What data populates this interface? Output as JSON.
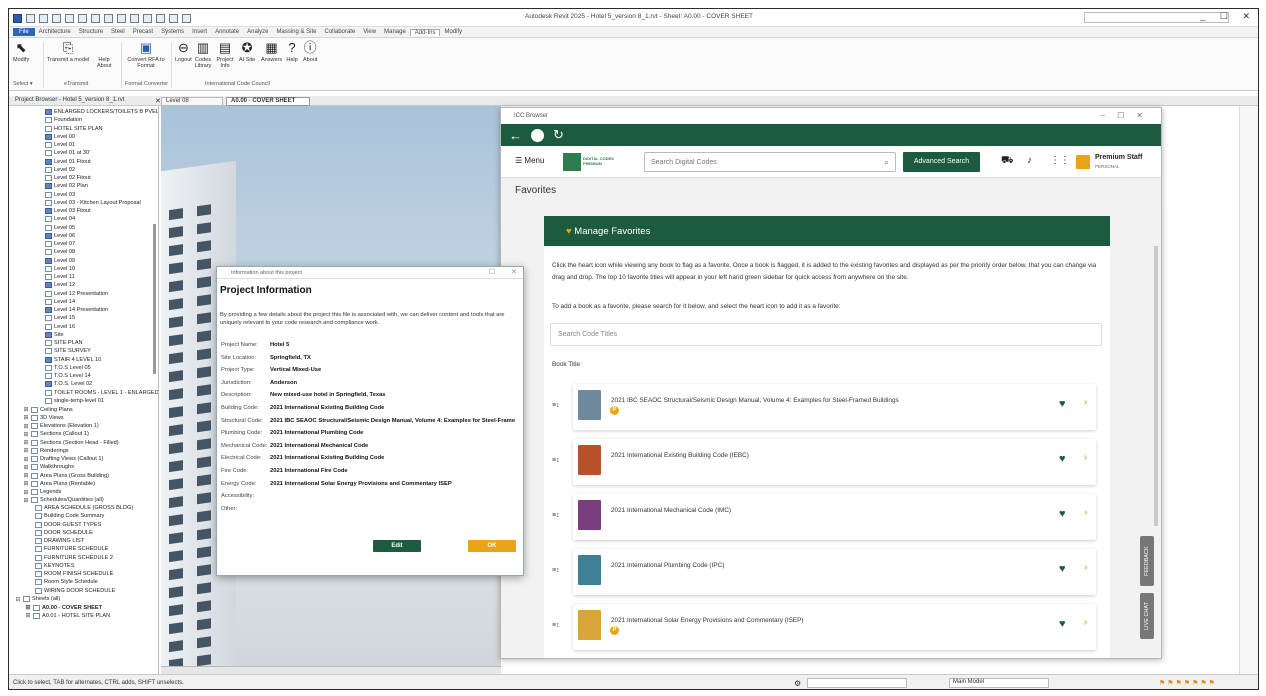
{
  "app": {
    "title": "Autodesk Revit 2025 - Hotel 5_version 8_1.rvt - Sheet: A0.00 - COVER SHEET",
    "window_controls": "_ ☐ ✕"
  },
  "ribbon": {
    "tabs": [
      "File",
      "Architecture",
      "Structure",
      "Steel",
      "Precast",
      "Systems",
      "Insert",
      "Annotate",
      "Analyze",
      "Massing & Site",
      "Collaborate",
      "View",
      "Manage",
      "Add-Ins",
      "Modify"
    ],
    "active_tab": "Add-Ins",
    "modify_label": "Modify",
    "select_label": "Select ▾",
    "transmit_label": "Transmit a model",
    "help_label": "Help",
    "about_label": "About",
    "esheet_label": "eTransmit",
    "convert_label": "Convert RFA to Format",
    "format_group": "Format Converter",
    "buttons": [
      "Logout",
      "Codes Library",
      "Project Info",
      "AI Site",
      "Answers",
      "Help",
      "About"
    ],
    "icc_group": "International Code Council"
  },
  "doc_tabs": {
    "browser_title": "Project Browser - Hotel 5_version 8_1.rvt",
    "tab1": "Level 08",
    "tab2": "A0.00 - COVER SHEET"
  },
  "browser": {
    "items": [
      "ENLARGED LOCKERS/TOILETS B PVEL",
      "Foundation",
      "HOTEL SITE PLAN",
      "Level 00",
      "Level 01",
      "Level 01 at 30'",
      "Level 01 Fitout",
      "Level 02",
      "Level 02 Fitout",
      "Level 02 Plan",
      "Level 03",
      "Level 03 - Kitchen Layout Proposal",
      "Level 03 Fitout",
      "Level 04",
      "Level 05",
      "Level 06",
      "Level 07",
      "Level 08",
      "Level 09",
      "Level 10",
      "Level 11",
      "Level 12",
      "Level 12 Presentation",
      "Level 14",
      "Level 14 Presentation",
      "Level 15",
      "Level 16",
      "Site",
      "SITE PLAN",
      "SITE SURVEY",
      "STAIR 4 LEVEL 10",
      "T.O.S Level 05",
      "T.O.S Level 14",
      "T.O.S. Level 02",
      "TOILET ROOMS - LEVEL 1 - ENLARGED",
      "single-temp-level 01"
    ],
    "groups": [
      "Ceiling Plans",
      "3D Views",
      "Elevations (Elevation 1)",
      "Sections (Callout 1)",
      "Sections (Section Head - Filled)",
      "Renderings",
      "Drafting Views (Callout 1)",
      "Walkthroughs",
      "Area Plans (Gross Building)",
      "Area Plans (Rentable)",
      "Legends",
      "Schedules/Quantities (all)"
    ],
    "schedules": [
      "AREA SCHEDULE (GROSS BLDG)",
      "Building Code Summary",
      "DOOR GUEST TYPES",
      "DOOR SCHEDULE",
      "DRAWING LIST",
      "FURNITURE SCHEDULE",
      "FURNITURE SCHEDULE 2",
      "KEYNOTES",
      "ROOM FINISH SCHEDULE",
      "Room Style Schedule",
      "WIRING DOOR SCHEDULE"
    ],
    "sheets_label": "Sheets (all)",
    "sheets": [
      "A0.00 - COVER SHEET",
      "A0.01 - HOTEL SITE PLAN"
    ]
  },
  "modal": {
    "window_title": "Information about this project",
    "title": "Project Information",
    "description": "By providing a few details about the project this file is associated with, we can deliver content and tools that are uniquely relevant to your code research and compliance work.",
    "fields": [
      {
        "label": "Project Name:",
        "value": "Hotel 5"
      },
      {
        "label": "Site Location:",
        "value": "Springfield, TX"
      },
      {
        "label": "Project Type:",
        "value": "Vertical Mixed-Use"
      },
      {
        "label": "Jurisdiction:",
        "value": "Anderson"
      },
      {
        "label": "Description:",
        "value": "New mixed-use hotel in Springfield, Texas"
      },
      {
        "label": "Building Code:",
        "value": "2021 International Existing Building Code"
      },
      {
        "label": "Structural Code:",
        "value": "2021 IBC SEAOC Structural/Seismic Design Manual, Volume 4: Examples for Steel-Frame"
      },
      {
        "label": "Plumbing Code:",
        "value": "2021 International Plumbing Code"
      },
      {
        "label": "Mechanical Code:",
        "value": "2021 International Mechanical Code"
      },
      {
        "label": "Electrical Code:",
        "value": "2021 International Existing Building Code"
      },
      {
        "label": "Fire Code:",
        "value": "2021 International Fire Code"
      },
      {
        "label": "Energy Code:",
        "value": "2021 International Solar Energy Provisions and Commentary ISEP"
      },
      {
        "label": "Accessibility:",
        "value": ""
      },
      {
        "label": "Other:",
        "value": ""
      }
    ],
    "edit_label": "Edit",
    "ok_label": "OK"
  },
  "icc": {
    "window_title": "ICC Browser",
    "menu_label": "Menu",
    "logo_text": "DIGITAL CODES PREMIUM",
    "search_placeholder": "Search Digital Codes",
    "advanced_search": "Advanced Search",
    "user_name": "Premium Staff",
    "user_sub": "PERSONAL",
    "favorites_label": "Favorites",
    "panel_title": "Manage Favorites",
    "para1": "Click the heart icon while viewing any book to flag as a favorite. Once a book is flagged, it is added to the existing favorites and displayed as per the priority order below, that you can change via drag and drop. The top 10 favorite titles will appear in your left hand green sidebar for quick access from anywhere on the site.",
    "para2": "To add a book as a favorite, please search for it below, and select the heart icon to add it as a favorite:",
    "search_titles_placeholder": "Search Code Titles",
    "book_title_label": "Book Title",
    "books": [
      {
        "title": "2021 IBC SEAOC Structural/Seismic Design Manual, Volume 4: Examples for Steel-Framed Buildings",
        "cover": "#6f8a9c",
        "badge": "P"
      },
      {
        "title": "2021 International Existing Building Code (IEBC)",
        "cover": "#b8502a",
        "badge": ""
      },
      {
        "title": "2021 International Mechanical Code (IMC)",
        "cover": "#7a3d7d",
        "badge": ""
      },
      {
        "title": "2021 International Plumbing Code (IPC)",
        "cover": "#3e7f95",
        "badge": ""
      },
      {
        "title": "2021 International Solar Energy Provisions and Commentary (ISEP)",
        "cover": "#d9a43a",
        "badge": "P"
      }
    ],
    "feedback_label": "FEEDBACK",
    "livechat_label": "LIVE CHAT"
  },
  "status": {
    "hint": "Click to select, TAB for alternates, CTRL adds, SHIFT unselects.",
    "model_label": "Main Model",
    "scale": "0"
  }
}
